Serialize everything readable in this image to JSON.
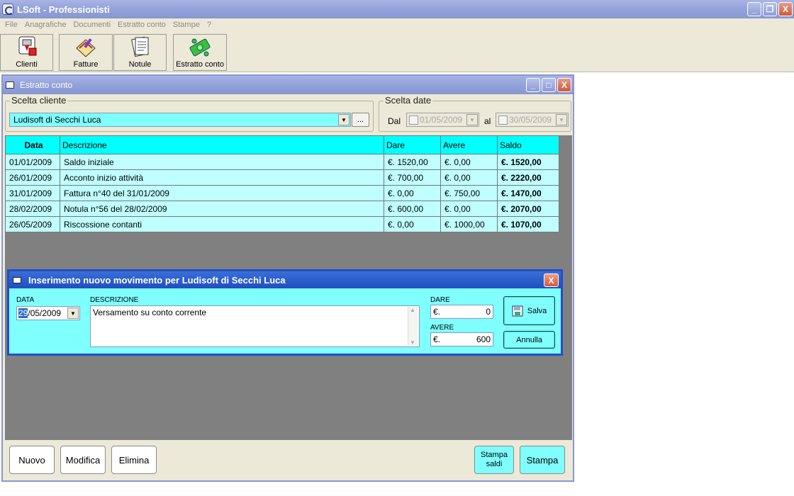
{
  "app": {
    "title": "LSoft - Professionisti",
    "window_buttons": {
      "minimize": "_",
      "restore": "❐",
      "close": "X"
    }
  },
  "menu": [
    "File",
    "Anagrafiche",
    "Documenti",
    "Estratto conto",
    "Stampe",
    "?"
  ],
  "toolbar": [
    {
      "label": "Clienti",
      "icon": "clients-icon"
    },
    {
      "label": "Fatture",
      "icon": "invoice-icon"
    },
    {
      "label": "Notule",
      "icon": "notes-icon"
    },
    {
      "label": "Estratto conto",
      "icon": "money-icon"
    }
  ],
  "child": {
    "title": "Estratto conto",
    "scelta_cliente": {
      "label": "Scelta cliente",
      "selected": "Ludisoft di Secchi Luca",
      "browse": "..."
    },
    "scelta_date": {
      "label": "Scelta date",
      "dal_label": "Dal",
      "dal_value": "01/05/2009",
      "al_label": "al",
      "al_value": "30/05/2009"
    },
    "grid": {
      "columns": [
        "Data",
        "Descrizione",
        "Dare",
        "Avere",
        "Saldo"
      ],
      "rows": [
        {
          "data": "01/01/2009",
          "descrizione": "Saldo iniziale",
          "dare": "€. 1520,00",
          "avere": "€. 0,00",
          "saldo": "€. 1520,00"
        },
        {
          "data": "26/01/2009",
          "descrizione": "Acconto inizio attività",
          "dare": "€. 700,00",
          "avere": "€. 0,00",
          "saldo": "€. 2220,00"
        },
        {
          "data": "31/01/2009",
          "descrizione": "Fattura n°40 del 31/01/2009",
          "dare": "€. 0,00",
          "avere": "€. 750,00",
          "saldo": "€. 1470,00"
        },
        {
          "data": "28/02/2009",
          "descrizione": "Notula n°56 del 28/02/2009",
          "dare": "€. 600,00",
          "avere": "€. 0,00",
          "saldo": "€. 2070,00"
        },
        {
          "data": "26/05/2009",
          "descrizione": "Riscossione contanti",
          "dare": "€. 0,00",
          "avere": "€. 1000,00",
          "saldo": "€. 1070,00"
        }
      ]
    },
    "buttons": {
      "nuovo": "Nuovo",
      "modifica": "Modifica",
      "elimina": "Elimina",
      "stampa_saldi_line1": "Stampa",
      "stampa_saldi_line2": "saldi",
      "stampa": "Stampa"
    }
  },
  "dialog": {
    "title": "Inserimento nuovo movimento per Ludisoft di Secchi Luca",
    "close": "X",
    "data_label": "DATA",
    "data_day": "29",
    "data_rest": "/05/2009",
    "descrizione_label": "DESCRIZIONE",
    "descrizione_value": "Versamento su conto corrente",
    "dare_label": "DARE",
    "dare_currency": "€.",
    "dare_value": "0",
    "avere_label": "AVERE",
    "avere_currency": "€.",
    "avere_value": "600",
    "salva": "Salva",
    "annulla": "Annulla"
  }
}
